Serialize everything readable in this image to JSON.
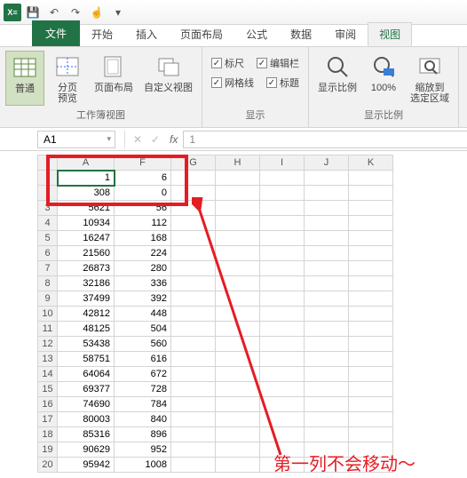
{
  "qa": {
    "save": "💾",
    "undo": "↶",
    "redo": "↷",
    "touch": "☝"
  },
  "tabs": {
    "file": "文件",
    "home": "开始",
    "insert": "插入",
    "layout": "页面布局",
    "formulas": "公式",
    "data": "数据",
    "review": "审阅",
    "view": "视图"
  },
  "ribbon": {
    "views": {
      "normal": "普通",
      "pagebreak": "分页\n预览",
      "pagelayout": "页面布局",
      "custom": "自定义视图",
      "group": "工作簿视图"
    },
    "show": {
      "ruler": "标尺",
      "formulabar": "编辑栏",
      "gridlines": "网格线",
      "headings": "标题",
      "group": "显示"
    },
    "zoom": {
      "zoom": "显示比例",
      "hundred": "100%",
      "selection": "缩放到\n选定区域",
      "group": "显示比例"
    }
  },
  "namebox": "A1",
  "formula": "1",
  "cols": [
    "A",
    "F",
    "G",
    "H",
    "I",
    "J",
    "K"
  ],
  "rows": [
    {
      "r": "",
      "a": "1",
      "f": "6"
    },
    {
      "r": "",
      "a": "308",
      "f": "0"
    },
    {
      "r": "3",
      "a": "5621",
      "f": "56"
    },
    {
      "r": "4",
      "a": "10934",
      "f": "112"
    },
    {
      "r": "5",
      "a": "16247",
      "f": "168"
    },
    {
      "r": "6",
      "a": "21560",
      "f": "224"
    },
    {
      "r": "7",
      "a": "26873",
      "f": "280"
    },
    {
      "r": "8",
      "a": "32186",
      "f": "336"
    },
    {
      "r": "9",
      "a": "37499",
      "f": "392"
    },
    {
      "r": "10",
      "a": "42812",
      "f": "448"
    },
    {
      "r": "11",
      "a": "48125",
      "f": "504"
    },
    {
      "r": "12",
      "a": "53438",
      "f": "560"
    },
    {
      "r": "13",
      "a": "58751",
      "f": "616"
    },
    {
      "r": "14",
      "a": "64064",
      "f": "672"
    },
    {
      "r": "15",
      "a": "69377",
      "f": "728"
    },
    {
      "r": "16",
      "a": "74690",
      "f": "784"
    },
    {
      "r": "17",
      "a": "80003",
      "f": "840"
    },
    {
      "r": "18",
      "a": "85316",
      "f": "896"
    },
    {
      "r": "19",
      "a": "90629",
      "f": "952"
    },
    {
      "r": "20",
      "a": "95942",
      "f": "1008"
    }
  ],
  "annotation": "第一列不会移动～"
}
